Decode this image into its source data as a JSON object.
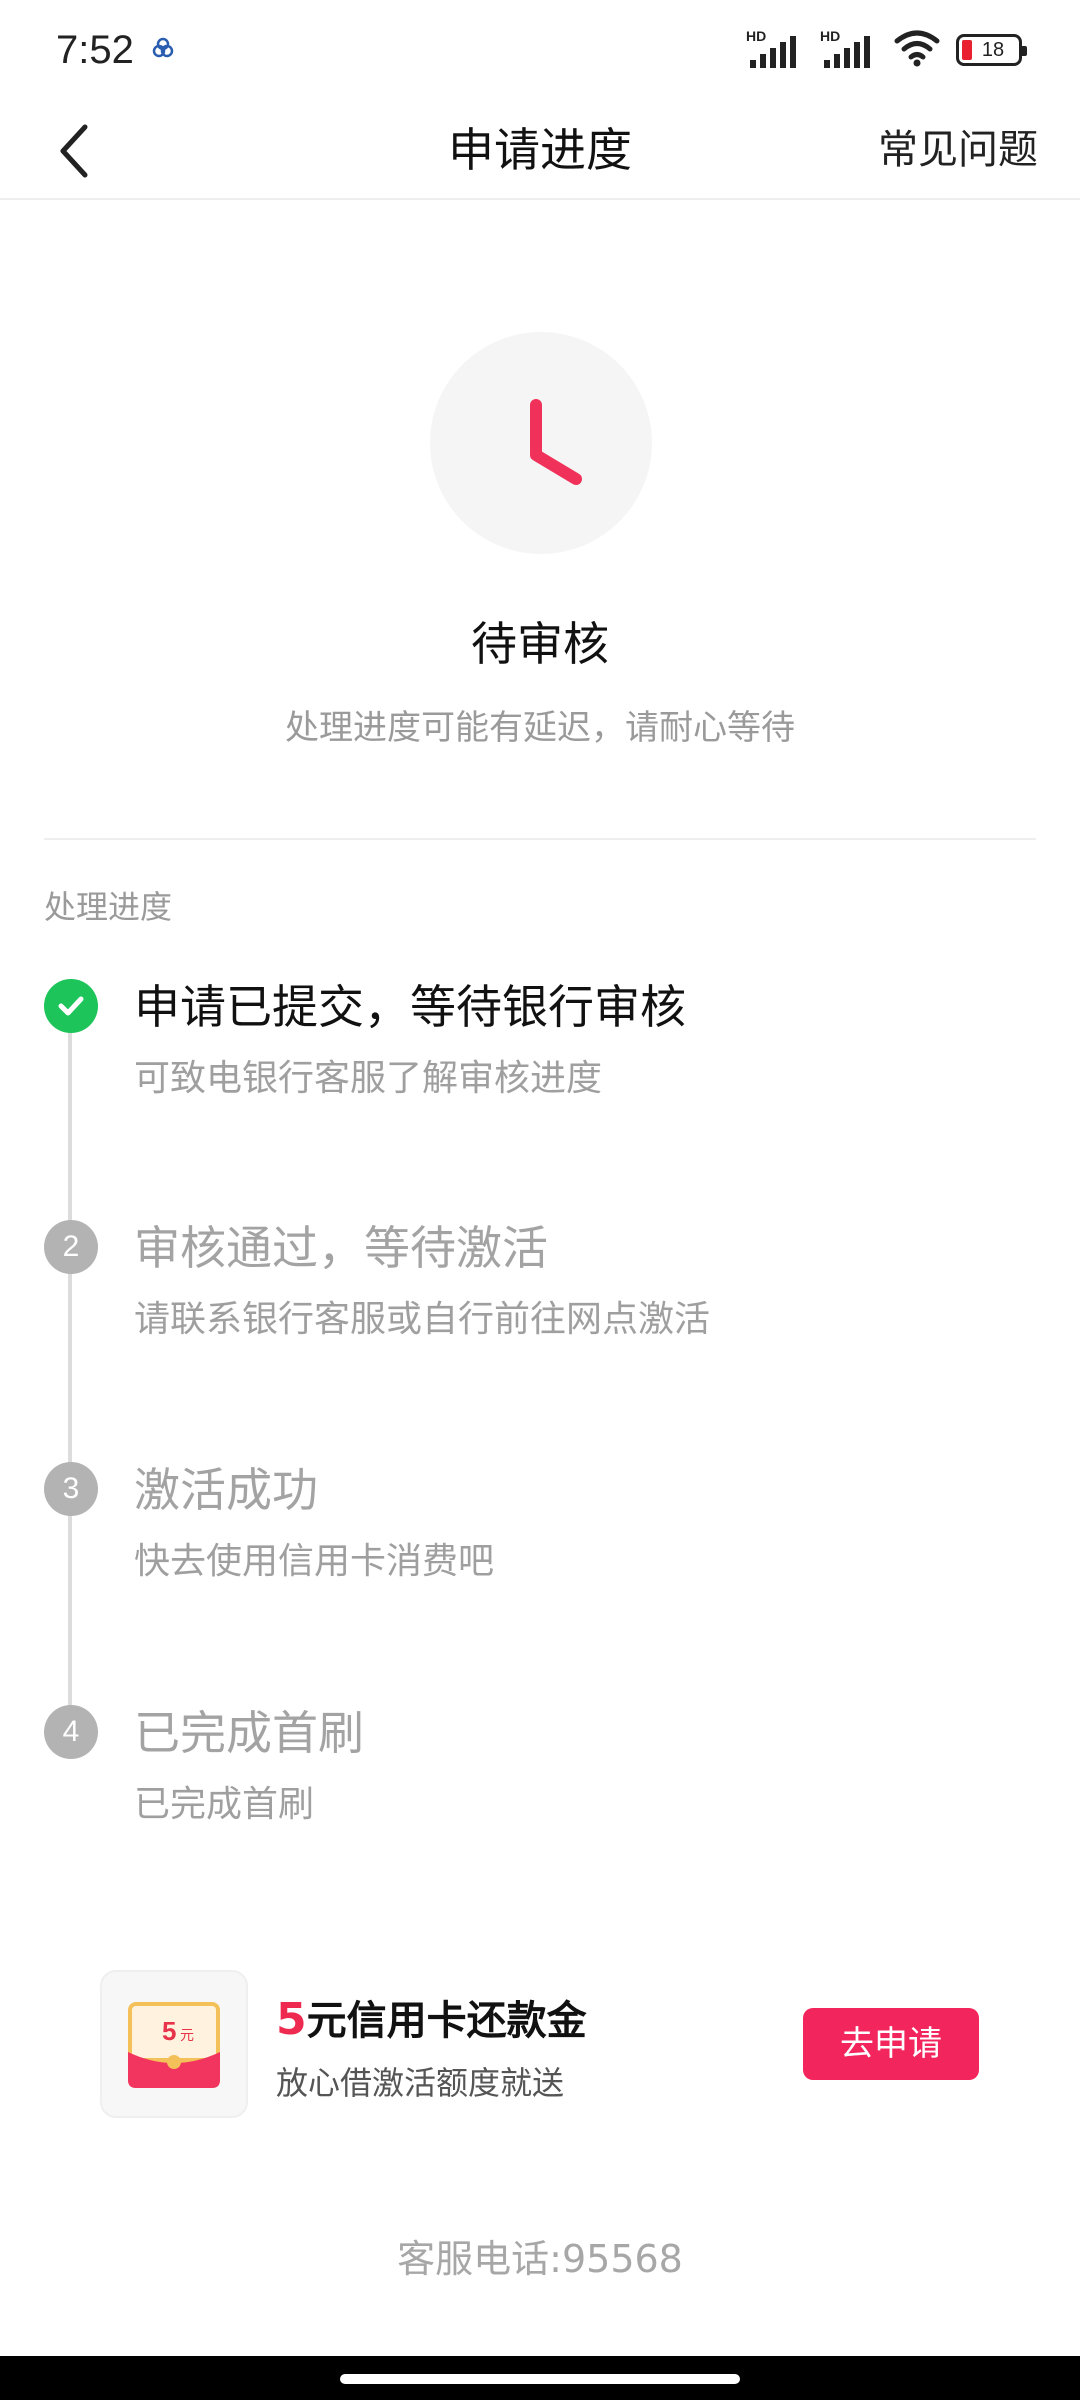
{
  "status_bar": {
    "time": "7:52",
    "signal_label": "HD",
    "battery": "18",
    "battery_level": 0.18
  },
  "header": {
    "title": "申请进度",
    "faq": "常见问题"
  },
  "status": {
    "title": "待审核",
    "subtitle": "处理进度可能有延迟，请耐心等待",
    "accent_color": "#f0325a"
  },
  "progress": {
    "section_label": "处理进度",
    "steps": [
      {
        "number": "",
        "title": "申请已提交，等待银行审核",
        "desc": "可致电银行客服了解审核进度",
        "state": "done"
      },
      {
        "number": "2",
        "title": "审核通过，等待激活",
        "desc": "请联系银行客服或自行前往网点激活",
        "state": "pending"
      },
      {
        "number": "3",
        "title": "激活成功",
        "desc": "快去使用信用卡消费吧",
        "state": "pending"
      },
      {
        "number": "4",
        "title": "已完成首刷",
        "desc": "已完成首刷",
        "state": "pending"
      }
    ]
  },
  "promo": {
    "amount": "5",
    "title_rest": "元信用卡还款金",
    "subtitle": "放心借激活额度就送",
    "button": "去申请",
    "icon_amount": "5",
    "icon_unit": "元",
    "button_color": "#f2255c"
  },
  "footer": {
    "hotline": "客服电话:95568"
  }
}
